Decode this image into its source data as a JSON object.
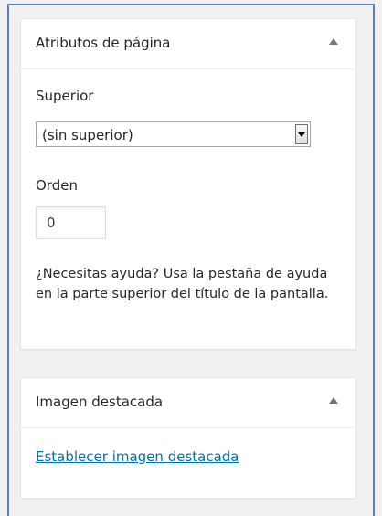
{
  "page_attributes": {
    "title": "Atributos de página",
    "parent_label": "Superior",
    "parent_selected": "(sin superior)",
    "order_label": "Orden",
    "order_value": "0",
    "help_text": "¿Necesitas ayuda? Usa la pestaña de ayuda en la parte superior del título de la pantalla."
  },
  "featured_image": {
    "title": "Imagen destacada",
    "set_link": "Establecer imagen destacada"
  },
  "icons": {
    "collapse": "triangle-up-icon",
    "select_dropdown": "chevron-down-icon"
  },
  "colors": {
    "link": "#0073aa",
    "focus_outline": "#5b7fbd",
    "panel_background": "#ffffff",
    "page_background": "#f1f1f1"
  }
}
